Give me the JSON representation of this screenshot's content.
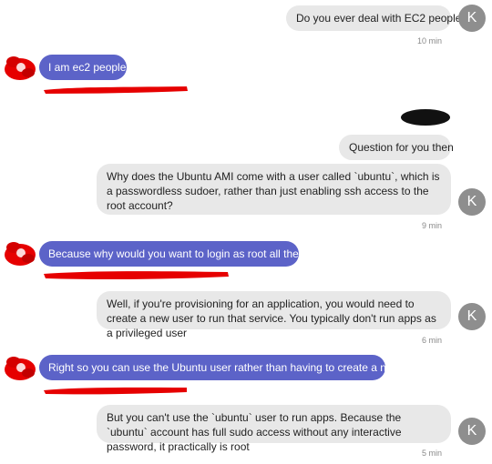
{
  "messages": [
    {
      "id": "m1",
      "side": "out",
      "text": "Do you ever deal with EC2 people?"
    },
    {
      "id": "m2",
      "side": "in",
      "text": "I am ec2 people"
    },
    {
      "id": "m3",
      "side": "out",
      "text": "Question for you then"
    },
    {
      "id": "m4",
      "side": "out",
      "text": "Why does the Ubuntu AMI come with a user called `ubuntu`, which is a passwordless sudoer, rather than just enabling ssh access to the root account?"
    },
    {
      "id": "m5",
      "side": "in",
      "text": "Because why would you want to login as root all the time"
    },
    {
      "id": "m6",
      "side": "out",
      "text": "Well, if you're provisioning for an application, you would need to create a new user to run that service. You typically don't run apps as a privileged user"
    },
    {
      "id": "m7",
      "side": "in",
      "text": "Right so you can use the Ubuntu user rather than having to create a new user"
    },
    {
      "id": "m8",
      "side": "out",
      "text": "But you can't use the `ubuntu` user to run apps. Because the `ubuntu` account has full sudo access without any interactive password, it practically is root"
    }
  ],
  "timestamps": {
    "t1": "10 min",
    "t2": "9 min",
    "t3": "6 min",
    "t4": "5 min"
  },
  "avatar_letter": "K",
  "colors": {
    "incoming_bubble": "#5c63c8",
    "outgoing_bubble": "#e8e8e8",
    "avatar_k": "#8e8e8e",
    "redaction": "#e60000"
  },
  "icons": {
    "incoming_avatar": "redacted-avatar-icon",
    "outgoing_avatar": "letter-avatar-icon"
  }
}
